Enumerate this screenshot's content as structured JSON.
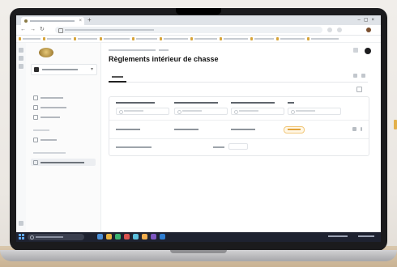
{
  "page": {
    "title": "Règlements intérieur de chasse"
  },
  "colors": {
    "background": "#ece8e3",
    "laptop_bezel": "#1b1b1d",
    "taskbar": "#1e2230",
    "status_badge": "#e3a33a",
    "logo_gold": "#a9873c"
  },
  "icons": {
    "browser": [
      "favicon-icon",
      "close-icon",
      "plus-icon",
      "back-icon",
      "forward-icon",
      "reload-icon",
      "lock-icon",
      "star-icon",
      "extension-icon",
      "profile-icon"
    ],
    "app": [
      "logo-icon",
      "chevron-down-icon",
      "home-icon",
      "people-icon",
      "rows-icon",
      "settings-icon",
      "gear-icon",
      "filter-icon",
      "search-icon",
      "edit-icon",
      "more-icon"
    ],
    "taskbar": [
      "windows-start-icon",
      "search-icon",
      "app-icon"
    ]
  }
}
